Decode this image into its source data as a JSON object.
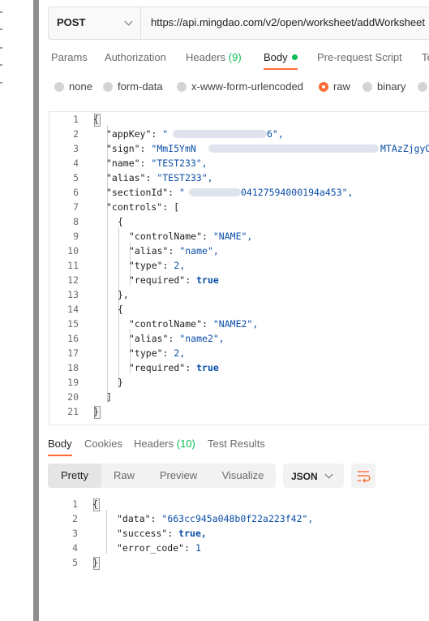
{
  "request": {
    "method": "POST",
    "url": "https://api.mingdao.com/v2/open/worksheet/addWorksheet"
  },
  "tabs": [
    {
      "label": "Params"
    },
    {
      "label": "Authorization"
    },
    {
      "label": "Headers",
      "count": "(9)"
    },
    {
      "label": "Body"
    },
    {
      "label": "Pre-request Script"
    },
    {
      "label": "Te"
    }
  ],
  "body_types": [
    "none",
    "form-data",
    "x-www-form-urlencoded",
    "raw",
    "binary",
    ""
  ],
  "selected_body_type": "raw",
  "request_body": {
    "line_numbers": [
      "1",
      "2",
      "3",
      "4",
      "5",
      "6",
      "7",
      "8",
      "9",
      "10",
      "11",
      "12",
      "13",
      "14",
      "15",
      "16",
      "17",
      "18",
      "19",
      "20",
      "21"
    ],
    "line2": {
      "key": "\"appKey\"",
      "value_end": "6\","
    },
    "line3": {
      "key": "\"sign\"",
      "value_start": "\"MmI5YmN",
      "value_end": "MTAzZjgyODV"
    },
    "line4": {
      "key": "\"name\"",
      "value": "\"TEST233\","
    },
    "line5": {
      "key": "\"alias\"",
      "value": "\"TEST233\","
    },
    "line6": {
      "key": "\"sectionId\"",
      "value_start": "\"",
      "value_end": "04127594000194a453\","
    },
    "line7": {
      "key": "\"controls\""
    },
    "c1": {
      "controlName": "\"NAME\",",
      "alias": "\"name\",",
      "type": "2,",
      "required": "true"
    },
    "c2": {
      "controlName": "\"NAME2\",",
      "alias": "\"name2\",",
      "type": "2,",
      "required": "true"
    },
    "keys": {
      "controlName": "\"controlName\"",
      "alias": "\"alias\"",
      "type": "\"type\"",
      "required": "\"required\""
    }
  },
  "response_tabs": [
    {
      "label": "Body"
    },
    {
      "label": "Cookies"
    },
    {
      "label": "Headers",
      "count": "(10)"
    },
    {
      "label": "Test Results"
    }
  ],
  "format_tabs": [
    "Pretty",
    "Raw",
    "Preview",
    "Visualize"
  ],
  "format_selected": "JSON",
  "response_body": {
    "line_numbers": [
      "1",
      "2",
      "3",
      "4",
      "5"
    ],
    "data_key": "\"data\"",
    "data_value": "\"663cc945a048b0f22a223f42\",",
    "success_key": "\"success\"",
    "success_value": "true,",
    "error_key": "\"error_code\"",
    "error_value": "1"
  },
  "icons": [
    "chevron-down-icon",
    "wrap-lines-icon"
  ],
  "colors": {
    "accent": "#ff6c37",
    "green": "#0cbb52",
    "string": "#0a4ea8"
  }
}
